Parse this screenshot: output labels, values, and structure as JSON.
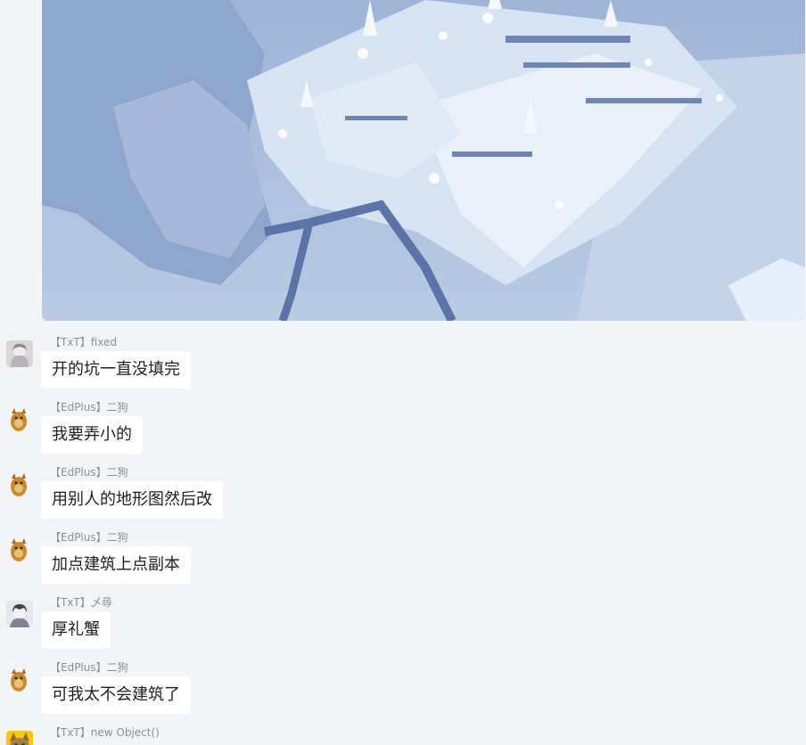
{
  "messages": [
    {
      "tag": "【TxT】",
      "name": "fixed",
      "text": "开的坑一直没填完",
      "avatar": "anime-girl-avatar"
    },
    {
      "tag": "【EdPlus】",
      "name": "二狗",
      "text": "我要弄小的",
      "avatar": "doge-avatar"
    },
    {
      "tag": "【EdPlus】",
      "name": "二狗",
      "text": "用别人的地形图然后改",
      "avatar": "doge-avatar"
    },
    {
      "tag": "【EdPlus】",
      "name": "二狗",
      "text": "加点建筑上点副本",
      "avatar": "doge-avatar"
    },
    {
      "tag": "【TxT】",
      "name": "乄尋",
      "text": "厚礼蟹",
      "avatar": "anime-boy-avatar"
    },
    {
      "tag": "【EdPlus】",
      "name": "二狗",
      "text": "可我太不会建筑了",
      "avatar": "doge-avatar"
    },
    {
      "tag": "【TxT】",
      "name": "new Object()",
      "text": "",
      "avatar": "cat-avatar"
    }
  ],
  "colors": {
    "background": "#f3f4f6",
    "bubble": "#ffffff",
    "sender": "#8a8f98",
    "snow": "#a9bedb"
  }
}
